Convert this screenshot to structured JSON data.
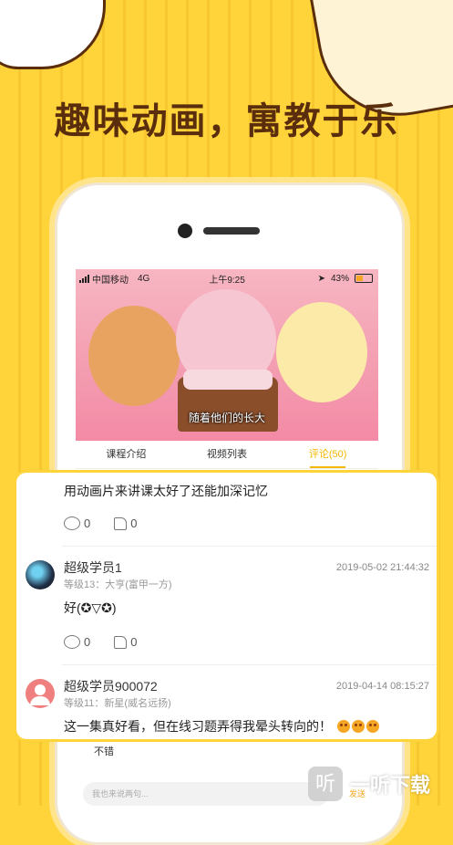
{
  "headline": "趣味动画，寓教于乐",
  "status_bar": {
    "carrier": "中国移动",
    "network": "4G",
    "time": "上午9:25",
    "battery": "43%"
  },
  "video": {
    "subtitle": "随着他们的长大"
  },
  "tabs": [
    {
      "label": "课程介绍",
      "active": false
    },
    {
      "label": "视频列表",
      "active": false
    },
    {
      "label": "评论(50)",
      "active": true
    }
  ],
  "comments": [
    {
      "text": "用动画片来讲课太好了还能加深记忆",
      "replies": "0",
      "likes": "0"
    },
    {
      "username": "超级学员1",
      "level": "等级13：大亨(富甲一方)",
      "date": "2019-05-02 21:44:32",
      "text": "好(✪▽✪)",
      "replies": "0",
      "likes": "0"
    },
    {
      "username": "超级学员900072",
      "level": "等级11：新星(威名远扬)",
      "date": "2019-04-14 08:15:27",
      "text": "这一集真好看，但在线习题弄得我晕头转向的！"
    }
  ],
  "behind_reply": "不错",
  "input": {
    "placeholder": "我也来说两句...",
    "send_label": "发送"
  },
  "watermark": {
    "logo_char": "听",
    "text": "一听下载"
  },
  "colors": {
    "background": "#FFD43B",
    "accent": "#F5B800",
    "headline": "#5a2d0c"
  }
}
